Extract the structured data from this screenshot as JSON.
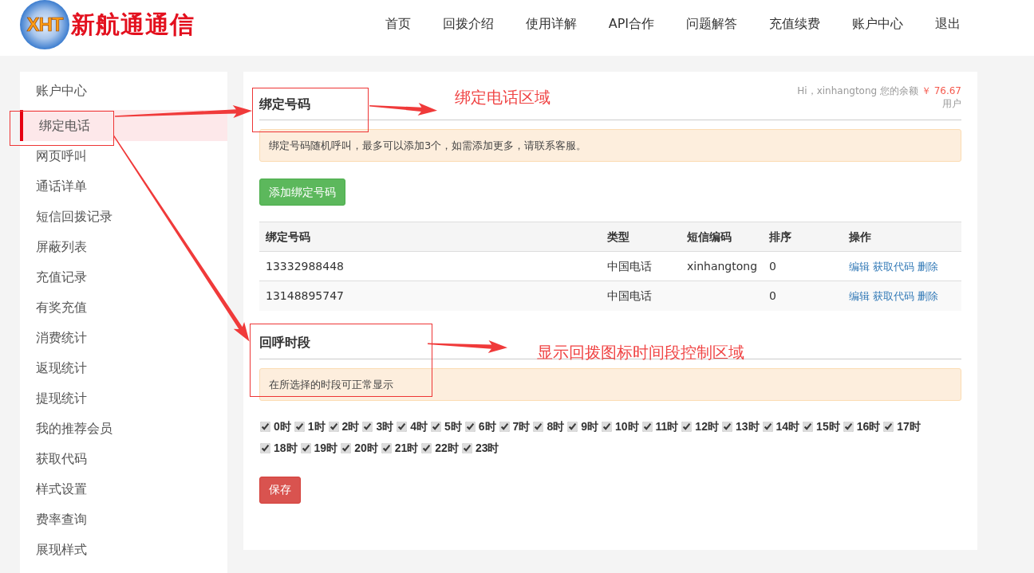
{
  "header": {
    "logo": {
      "mark": "XHT",
      "name": "新航通通信"
    },
    "nav": [
      {
        "label": "首页"
      },
      {
        "label": "回拨介绍"
      },
      {
        "label": "使用详解"
      },
      {
        "label": "API合作"
      },
      {
        "label": "问题解答"
      },
      {
        "label": "充值续费"
      },
      {
        "label": "账户中心"
      },
      {
        "label": "退出"
      }
    ]
  },
  "sidebar": {
    "items": [
      {
        "label": "账户中心",
        "selected": false
      },
      {
        "label": "绑定电话",
        "selected": true
      },
      {
        "label": "网页呼叫",
        "selected": false
      },
      {
        "label": "通话详单",
        "selected": false
      },
      {
        "label": "短信回拨记录",
        "selected": false
      },
      {
        "label": "屏蔽列表",
        "selected": false
      },
      {
        "label": "充值记录",
        "selected": false
      },
      {
        "label": "有奖充值",
        "selected": false
      },
      {
        "label": "消费统计",
        "selected": false
      },
      {
        "label": "返现统计",
        "selected": false
      },
      {
        "label": "提现统计",
        "selected": false
      },
      {
        "label": "我的推荐会员",
        "selected": false
      },
      {
        "label": "获取代码",
        "selected": false
      },
      {
        "label": "样式设置",
        "selected": false
      },
      {
        "label": "费率查询",
        "selected": false
      },
      {
        "label": "展现样式",
        "selected": false
      }
    ]
  },
  "account": {
    "greeting": "Hi，xinhangtong 您的余额",
    "balance": "￥ 76.67",
    "role": "用户"
  },
  "bound_numbers": {
    "title": "绑定号码",
    "notice": "绑定号码随机呼叫，最多可以添加3个，如需添加更多，请联系客服。",
    "add_button": "添加绑定号码",
    "table": {
      "columns": [
        "绑定号码",
        "类型",
        "短信编码",
        "排序",
        "操作"
      ],
      "rows": [
        {
          "number": "13332988448",
          "type": "中国电话",
          "sms_code": "xinhangtong",
          "order": "0",
          "actions": [
            "编辑",
            "获取代码",
            "删除"
          ]
        },
        {
          "number": "13148895747",
          "type": "中国电话",
          "order": "0",
          "actions": [
            "编辑",
            "获取代码",
            "删除"
          ]
        }
      ]
    }
  },
  "callback_period": {
    "title": "回呼时段",
    "notice": "在所选择的时段可正常显示",
    "hours": [
      {
        "label": "0时",
        "checked": true
      },
      {
        "label": "1时",
        "checked": true
      },
      {
        "label": "2时",
        "checked": true
      },
      {
        "label": "3时",
        "checked": true
      },
      {
        "label": "4时",
        "checked": true
      },
      {
        "label": "5时",
        "checked": true
      },
      {
        "label": "6时",
        "checked": true
      },
      {
        "label": "7时",
        "checked": true
      },
      {
        "label": "8时",
        "checked": true
      },
      {
        "label": "9时",
        "checked": true
      },
      {
        "label": "10时",
        "checked": true
      },
      {
        "label": "11时",
        "checked": true
      },
      {
        "label": "12时",
        "checked": true
      },
      {
        "label": "13时",
        "checked": true
      },
      {
        "label": "14时",
        "checked": true
      },
      {
        "label": "15时",
        "checked": true
      },
      {
        "label": "16时",
        "checked": true
      },
      {
        "label": "17时",
        "checked": true
      },
      {
        "label": "18时",
        "checked": true
      },
      {
        "label": "19时",
        "checked": true
      },
      {
        "label": "20时",
        "checked": true
      },
      {
        "label": "21时",
        "checked": true
      },
      {
        "label": "22时",
        "checked": true
      },
      {
        "label": "23时",
        "checked": true
      }
    ],
    "save_button": "保存"
  },
  "annotations": [
    {
      "text": "绑定电话区域"
    },
    {
      "text": "显示回拨图标时间段控制区域"
    }
  ]
}
